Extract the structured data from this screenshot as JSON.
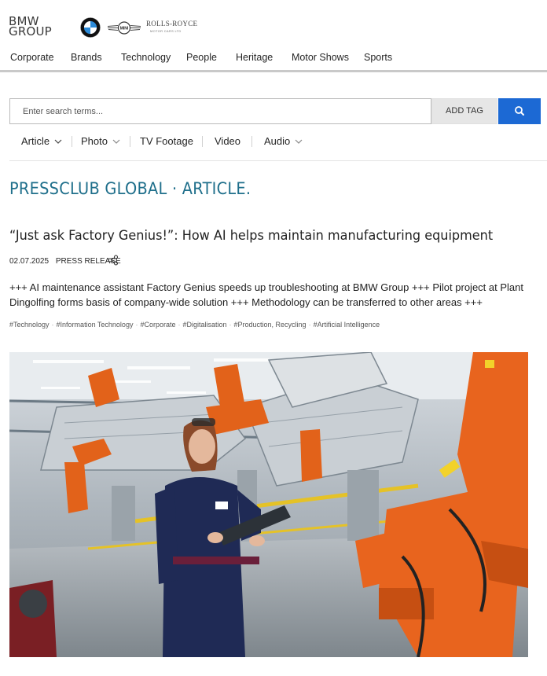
{
  "header": {
    "logo_line1": "BMW",
    "logo_line2": "GROUP",
    "rr_name": "ROLLS-ROYCE",
    "rr_sub": "MOTOR CARS LTD",
    "nav": [
      "Corporate",
      "Brands",
      "Technology",
      "People",
      "Heritage",
      "Motor Shows",
      "Sports"
    ]
  },
  "search": {
    "placeholder": "Enter search terms...",
    "add_tag_label": "ADD TAG"
  },
  "filters": [
    "Article",
    "Photo",
    "TV Footage",
    "Video",
    "Audio"
  ],
  "page_heading": "PRESSCLUB GLOBAL · ARTICLE.",
  "article": {
    "title": "“Just ask Factory Genius!”: How AI helps maintain manufacturing equipment",
    "date": "02.07.2025",
    "type": "PRESS RELEASE",
    "summary": "+++ AI maintenance assistant Factory Genius speeds up troubleshooting at BMW Group +++ Pilot project at Plant Dingolfing forms basis of company-wide solution +++ Methodology can be transferred to other areas +++",
    "tags": [
      "#Technology",
      "#Information Technology",
      "#Corporate",
      "#Digitalisation",
      "#Production, Recycling",
      "#Artificial Intelligence"
    ]
  },
  "colors": {
    "accent_blue": "#1c69d4",
    "heading_teal": "#1f6f8b",
    "robot_orange": "#e8641e"
  }
}
